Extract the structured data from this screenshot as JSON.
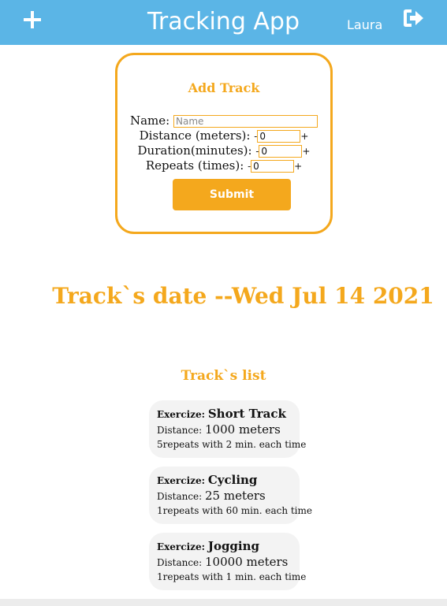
{
  "header": {
    "title": "Tracking App",
    "user": "Laura",
    "add_icon": "plus-icon",
    "logout_icon": "sign-out-icon",
    "bg_color": "#5bb5e6"
  },
  "form": {
    "title": "Add Track",
    "name_label": "Name:",
    "name_placeholder": "Name",
    "distance_label": "Distance (meters):",
    "distance_value": "0",
    "duration_label": "Duration(minutes):",
    "duration_value": "0",
    "repeats_label": "Repeats (times):",
    "repeats_value": "0",
    "minus": "-",
    "plus": "+",
    "submit_label": "Submit",
    "accent_color": "#f4a81d"
  },
  "date_heading": "Track`s date --Wed Jul 14 2021",
  "list": {
    "title": "Track`s list",
    "exercise_key": "Exercize:",
    "distance_key": "Distance:",
    "items": [
      {
        "name": "Short Track",
        "distance": "1000 meters",
        "summary": "5repeats with 2 min. each time"
      },
      {
        "name": "Cycling",
        "distance": "25 meters",
        "summary": "1repeats with 60 min. each time"
      },
      {
        "name": "Jogging",
        "distance": "10000 meters",
        "summary": "1repeats with 1 min. each time"
      }
    ]
  }
}
